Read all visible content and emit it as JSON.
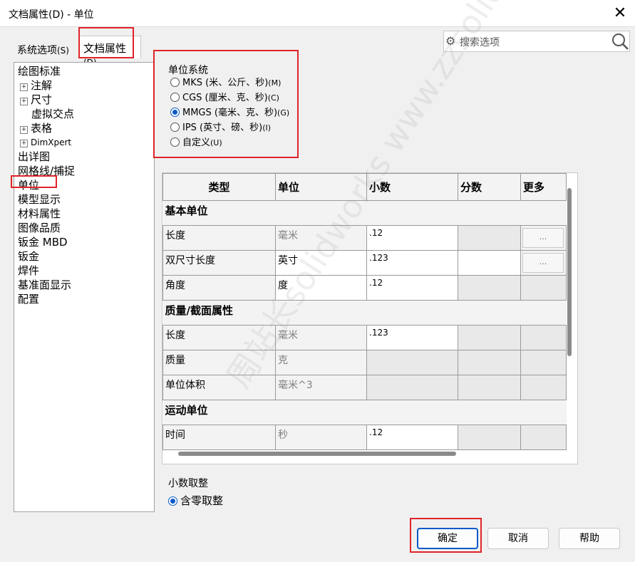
{
  "window": {
    "title": "文档属性(D) - 单位",
    "close_glyph": "✕"
  },
  "tabs": [
    {
      "label": "系统选项",
      "hotkey": "(S)"
    },
    {
      "label": "文档属性",
      "hotkey": "(D)"
    }
  ],
  "search": {
    "placeholder": "搜索选项",
    "gear_icon": "gear-icon",
    "search_icon": "search-icon"
  },
  "tree": {
    "items": [
      {
        "label": "绘图标准"
      },
      {
        "label": "注解"
      },
      {
        "label": "尺寸"
      },
      {
        "label": "虚拟交点"
      },
      {
        "label": "表格"
      },
      {
        "label": "DimXpert"
      },
      {
        "label": "出详图"
      },
      {
        "label": "网格线/捕捉"
      },
      {
        "label": "单位"
      },
      {
        "label": "模型显示"
      },
      {
        "label": "材料属性"
      },
      {
        "label": "图像品质"
      },
      {
        "label": "钣金 MBD"
      },
      {
        "label": "钣金"
      },
      {
        "label": "焊件"
      },
      {
        "label": "基准面显示"
      },
      {
        "label": "配置"
      }
    ],
    "selected": "单位"
  },
  "unit_system": {
    "label": "单位系统",
    "options": [
      {
        "label": "MKS (米、公斤、秒)",
        "hotkey": "(M)",
        "checked": false
      },
      {
        "label": "CGS (厘米、克、秒)",
        "hotkey": "(C)",
        "checked": false
      },
      {
        "label": "MMGS (毫米、克、秒)",
        "hotkey": "(G)",
        "checked": true
      },
      {
        "label": "IPS (英寸、磅、秒)",
        "hotkey": "(I)",
        "checked": false
      },
      {
        "label": "自定义",
        "hotkey": "(U)",
        "checked": false
      }
    ]
  },
  "unit_table": {
    "headers": [
      "类型",
      "单位",
      "小数",
      "分数",
      "更多"
    ],
    "sections": {
      "basic": "基本单位",
      "mass": "质量/截面属性",
      "motion": "运动单位"
    },
    "rows": {
      "length": {
        "type": "长度",
        "unit": "毫米",
        "decimal": ".12",
        "more": "..."
      },
      "dual": {
        "type": "双尺寸长度",
        "unit": "英寸",
        "decimal": ".123",
        "more": "..."
      },
      "angle": {
        "type": "角度",
        "unit": "度",
        "decimal": ".12"
      },
      "mass_length": {
        "type": "长度",
        "unit": "毫米",
        "decimal": ".123"
      },
      "mass": {
        "type": "质量",
        "unit": "克"
      },
      "volume": {
        "type": "单位体积",
        "unit": "毫米^3"
      },
      "time": {
        "type": "时间",
        "unit": "秒",
        "decimal": ".12"
      }
    }
  },
  "rounding": {
    "label": "小数取整",
    "option": {
      "label": "含零取整",
      "checked": true
    }
  },
  "buttons": {
    "ok": "确定",
    "cancel": "取消",
    "help": "帮助"
  },
  "watermark": "周站长solidworks www.zzsolidworks.com",
  "colors": {
    "accent": "#0a5ac8",
    "highlight_box": "#e0242a"
  }
}
